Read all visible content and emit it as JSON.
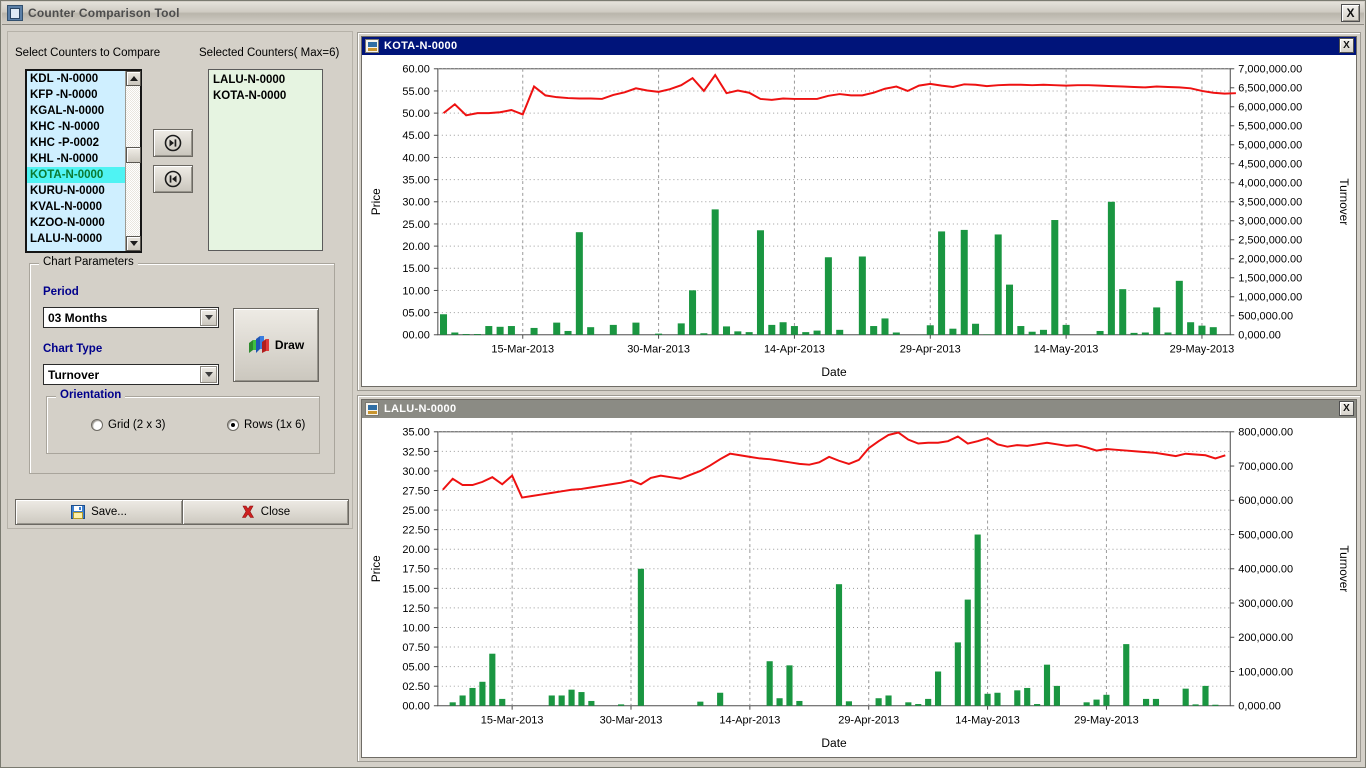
{
  "window": {
    "title": "Counter Comparison Tool",
    "icon": "app-icon",
    "close_label": "X"
  },
  "left_panel": {
    "available_caption": "Select Counters to Compare",
    "selected_caption": "Selected Counters( Max=6)",
    "available_counters": [
      {
        "label": "KDL -N-0000",
        "selected": false
      },
      {
        "label": "KFP -N-0000",
        "selected": false
      },
      {
        "label": "KGAL-N-0000",
        "selected": false
      },
      {
        "label": "KHC -N-0000",
        "selected": false
      },
      {
        "label": "KHC -P-0002",
        "selected": false
      },
      {
        "label": "KHL -N-0000",
        "selected": false
      },
      {
        "label": "KOTA-N-0000",
        "selected": true
      },
      {
        "label": "KURU-N-0000",
        "selected": false
      },
      {
        "label": "KVAL-N-0000",
        "selected": false
      },
      {
        "label": "KZOO-N-0000",
        "selected": false
      },
      {
        "label": "LALU-N-0000",
        "selected": false
      }
    ],
    "selected_counters": [
      "LALU-N-0000",
      "KOTA-N-0000"
    ],
    "add_button": "add-counter-button",
    "remove_button": "remove-counter-button",
    "highlight_color": "#4ff3f3",
    "highlight_text_color": "#0b7a33"
  },
  "chart_parameters": {
    "group_title": "Chart Parameters",
    "period_label": "Period",
    "period_value": "03 Months",
    "chart_type_label": "Chart Type",
    "chart_type_value": "Turnover",
    "draw_label": "Draw",
    "orientation": {
      "group_title": "Orientation",
      "options": [
        {
          "label": "Grid (2 x 3)",
          "checked": false
        },
        {
          "label": "Rows (1x 6)",
          "checked": true
        }
      ]
    }
  },
  "footer": {
    "save_label": "Save...",
    "close_label": "Close"
  },
  "chart_data": [
    {
      "type": "bar",
      "title": "KOTA-N-0000",
      "window_active": true,
      "xlabel": "Date",
      "ylabel": "Price",
      "y2label": "Turnover",
      "grid": true,
      "legend": "none",
      "bar_color": "#1a9641",
      "line_color": "#ee1111",
      "xtick_labels": [
        "15-Mar-2013",
        "30-Mar-2013",
        "14-Apr-2013",
        "29-Apr-2013",
        "14-May-2013",
        "29-May-2013"
      ],
      "xtick_positions": [
        7,
        19,
        31,
        43,
        55,
        67
      ],
      "ytick_labels": [
        "00.00",
        "05.00",
        "10.00",
        "15.00",
        "20.00",
        "25.00",
        "30.00",
        "35.00",
        "40.00",
        "45.00",
        "50.00",
        "55.00",
        "60.00"
      ],
      "ylim": [
        0,
        60
      ],
      "y2tick_labels": [
        "0,000.00",
        "500,000.00",
        "1,000,000.00",
        "1,500,000.00",
        "2,000,000.00",
        "2,500,000.00",
        "3,000,000.00",
        "3,500,000.00",
        "4,000,000.00",
        "4,500,000.00",
        "5,000,000.00",
        "5,500,000.00",
        "6,000,000.00",
        "6,500,000.00",
        "7,000,000.00"
      ],
      "y2lim": [
        0,
        7000000
      ],
      "series": [
        {
          "name": "Turnover",
          "axis": "right",
          "kind": "bar",
          "values": [
            540000,
            60000,
            20000,
            20000,
            230000,
            210000,
            230000,
            0,
            180000,
            0,
            320000,
            100000,
            2700000,
            200000,
            0,
            260000,
            0,
            320000,
            0,
            30000,
            0,
            300000,
            1170000,
            40000,
            3300000,
            220000,
            90000,
            70000,
            2750000,
            260000,
            330000,
            230000,
            70000,
            110000,
            2040000,
            130000,
            0,
            2060000,
            230000,
            430000,
            60000,
            0,
            2000,
            250000,
            2720000,
            160000,
            2760000,
            290000,
            10000,
            2640000,
            1320000,
            230000,
            80000,
            130000,
            3020000,
            260000,
            0,
            0,
            100000,
            3500000,
            1200000,
            50000,
            60000,
            720000,
            60000,
            1420000,
            330000,
            240000,
            200000,
            0
          ]
        },
        {
          "name": "Price",
          "axis": "left",
          "kind": "line",
          "values": [
            50.0,
            52.0,
            49.5,
            50.0,
            50.0,
            50.2,
            50.7,
            49.7,
            56.0,
            54.0,
            53.6,
            53.4,
            53.3,
            53.3,
            53.2,
            54.1,
            54.7,
            55.6,
            55.1,
            54.8,
            55.4,
            56.3,
            57.9,
            55.0,
            58.6,
            54.5,
            55.1,
            54.6,
            53.2,
            53.0,
            53.3,
            53.2,
            53.2,
            53.2,
            53.9,
            54.3,
            54.0,
            54.0,
            54.6,
            55.5,
            56.0,
            55.0,
            56.2,
            56.6,
            56.2,
            55.9,
            56.5,
            56.4,
            56.1,
            56.3,
            56.4,
            56.4,
            56.3,
            56.4,
            56.3,
            56.2,
            56.3,
            56.3,
            56.2,
            56.1,
            56.0,
            55.9,
            55.8,
            56.0,
            55.9,
            55.8,
            55.6,
            55.0,
            54.6,
            54.4,
            54.5
          ]
        }
      ]
    },
    {
      "type": "bar",
      "title": "LALU-N-0000",
      "window_active": false,
      "xlabel": "Date",
      "ylabel": "Price",
      "y2label": "Turnover",
      "grid": true,
      "legend": "none",
      "bar_color": "#1a9641",
      "line_color": "#ee1111",
      "xtick_labels": [
        "15-Mar-2013",
        "30-Mar-2013",
        "14-Apr-2013",
        "29-Apr-2013",
        "14-May-2013",
        "29-May-2013"
      ],
      "xtick_positions": [
        7,
        19,
        31,
        43,
        55,
        67
      ],
      "ytick_labels": [
        "00.00",
        "02.50",
        "05.00",
        "07.50",
        "10.00",
        "12.50",
        "15.00",
        "17.50",
        "20.00",
        "22.50",
        "25.00",
        "27.50",
        "30.00",
        "32.50",
        "35.00"
      ],
      "ylim": [
        0,
        35
      ],
      "y2tick_labels": [
        "0,000.00",
        "100,000.00",
        "200,000.00",
        "300,000.00",
        "400,000.00",
        "500,000.00",
        "600,000.00",
        "700,000.00",
        "800,000.00"
      ],
      "y2lim": [
        0,
        800000
      ],
      "series": [
        {
          "name": "Turnover",
          "axis": "right",
          "kind": "bar",
          "values": [
            0,
            10000,
            30000,
            52000,
            70000,
            152000,
            20000,
            0,
            0,
            0,
            0,
            30000,
            30000,
            47000,
            40000,
            14000,
            0,
            0,
            4000,
            0,
            400000,
            0,
            0,
            0,
            0,
            0,
            12000,
            0,
            38000,
            0,
            0,
            0,
            0,
            130000,
            22000,
            118000,
            14000,
            0,
            0,
            0,
            355000,
            13000,
            0,
            0,
            22000,
            30000,
            0,
            10000,
            5000,
            20000,
            100000,
            0,
            185000,
            310000,
            500000,
            35000,
            38000,
            0,
            45000,
            52000,
            5000,
            120000,
            58000,
            0,
            0,
            10000,
            18000,
            32000,
            0,
            180000,
            0,
            20000,
            20000,
            0,
            0,
            50000,
            4000,
            58000,
            3000,
            0
          ]
        },
        {
          "name": "Price",
          "axis": "left",
          "kind": "line",
          "values": [
            27.6,
            29.0,
            28.2,
            28.2,
            28.6,
            29.2,
            28.3,
            29.4,
            26.6,
            26.8,
            27.0,
            27.2,
            27.4,
            27.6,
            27.7,
            27.9,
            28.1,
            28.3,
            28.5,
            28.8,
            28.3,
            29.1,
            29.4,
            29.2,
            29.0,
            29.5,
            30.0,
            30.7,
            31.5,
            32.2,
            32.0,
            31.8,
            31.6,
            31.5,
            31.3,
            31.1,
            30.9,
            30.8,
            31.1,
            31.8,
            31.3,
            30.9,
            31.4,
            32.9,
            33.8,
            34.6,
            34.9,
            34.0,
            33.5,
            33.6,
            33.6,
            33.8,
            34.4,
            33.5,
            33.8,
            34.2,
            33.4,
            33.1,
            33.3,
            33.2,
            33.4,
            33.6,
            33.4,
            33.2,
            33.3,
            33.0,
            32.6,
            32.8,
            32.7,
            32.6,
            32.5,
            32.4,
            32.3,
            32.1,
            31.9,
            32.2,
            32.1,
            32.0,
            31.6,
            32.0
          ]
        }
      ]
    }
  ]
}
